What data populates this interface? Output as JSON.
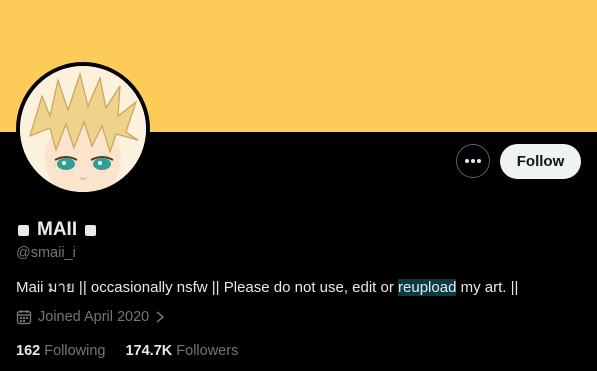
{
  "banner": {
    "color": "#fdcb58"
  },
  "profile": {
    "display_name": "MAII",
    "handle": "@smaii_i",
    "bio_before": "Maii มาย || occasionally nsfw || Please do not use, edit or ",
    "bio_highlight": "reupload",
    "bio_after": " my art. ||",
    "joined": "Joined April 2020"
  },
  "actions": {
    "follow_label": "Follow",
    "more_icon": "more-dots-icon"
  },
  "stats": {
    "following_count": "162",
    "following_label": "Following",
    "followers_count": "174.7K",
    "followers_label": "Followers"
  },
  "colors": {
    "background": "#000000",
    "text_primary": "#e7e9ea",
    "text_secondary": "#71767b",
    "follow_button_bg": "#eff3f4",
    "highlight": "#0b3a43"
  }
}
